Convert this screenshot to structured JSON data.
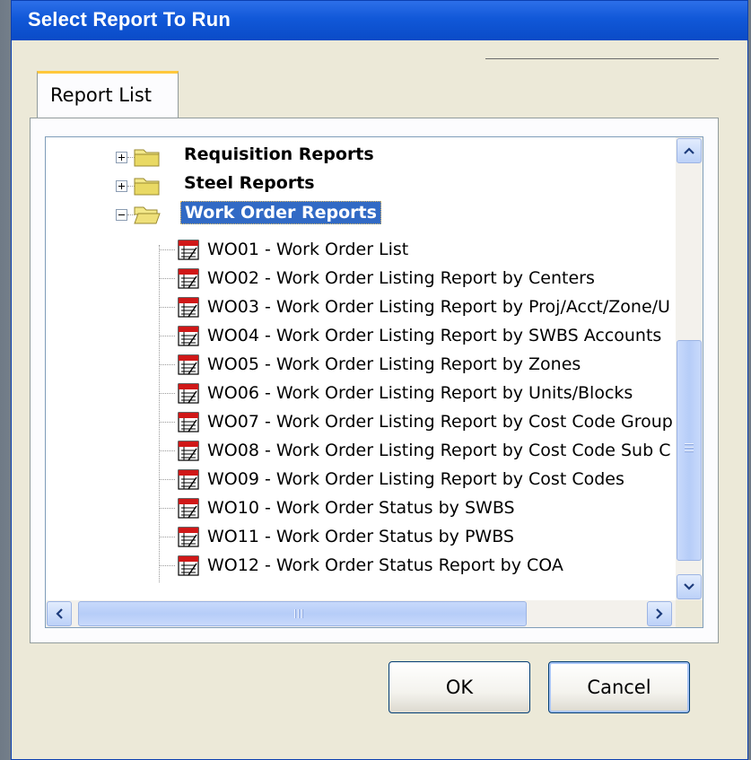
{
  "window": {
    "title": "Select Report To Run"
  },
  "tabs": [
    {
      "label": "Report List",
      "active": true
    }
  ],
  "tree": {
    "folders": [
      {
        "label": "Requisition Reports",
        "expanded": false,
        "selected": false,
        "icon": "folder-closed-icon"
      },
      {
        "label": "Steel Reports",
        "expanded": false,
        "selected": false,
        "icon": "folder-closed-icon"
      },
      {
        "label": "Work Order Reports",
        "expanded": true,
        "selected": true,
        "icon": "folder-open-icon"
      }
    ],
    "reports": [
      {
        "label": "WO01 - Work Order List"
      },
      {
        "label": "WO02 - Work Order Listing Report by Centers"
      },
      {
        "label": "WO03 - Work Order Listing Report by Proj/Acct/Zone/U"
      },
      {
        "label": "WO04 - Work Order Listing Report by SWBS Accounts"
      },
      {
        "label": "WO05 - Work Order Listing Report by Zones"
      },
      {
        "label": "WO06 - Work Order Listing Report by Units/Blocks"
      },
      {
        "label": "WO07 - Work Order Listing Report by Cost Code Group"
      },
      {
        "label": "WO08 - Work Order Listing Report by Cost Code Sub C"
      },
      {
        "label": "WO09 - Work Order Listing Report by Cost Codes"
      },
      {
        "label": "WO10 - Work Order Status by SWBS"
      },
      {
        "label": "WO11 - Work Order Status by PWBS"
      },
      {
        "label": "WO12 - Work Order Status Report by COA"
      }
    ]
  },
  "buttons": {
    "ok_label": "OK",
    "cancel_label": "Cancel"
  },
  "colors": {
    "titlebar": "#0a4bc7",
    "selection": "#316ac5",
    "tab_accent": "#ffc83c",
    "dialog_bg": "#ece9d8"
  }
}
